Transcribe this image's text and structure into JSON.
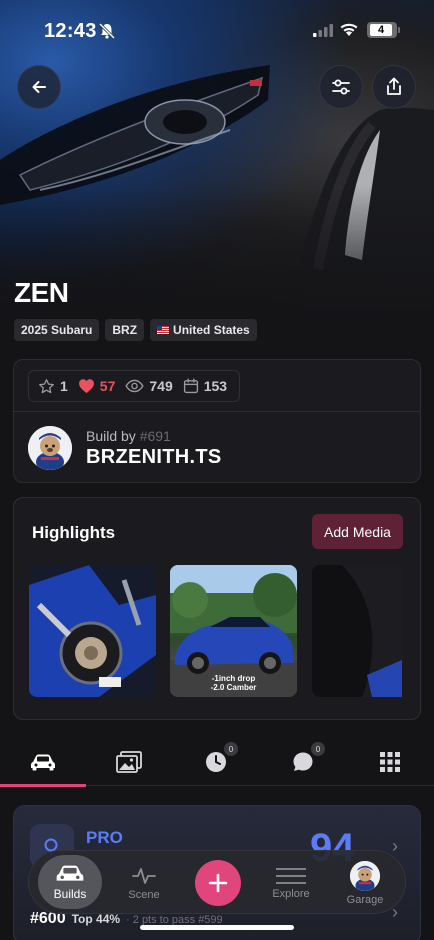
{
  "status_bar": {
    "time": "12:43",
    "battery": "4"
  },
  "header": {
    "title": "ZEN",
    "tags": [
      "2025 Subaru",
      "BRZ",
      "United States"
    ]
  },
  "stats": {
    "stars": "1",
    "likes": "57",
    "views": "749",
    "days": "153"
  },
  "owner": {
    "build_by_label": "Build by",
    "build_number": "#691",
    "name": "BRZENITH.TS"
  },
  "highlights": {
    "title": "Highlights",
    "add_media_label": "Add Media",
    "thumb_caption_line1": "-1inch drop",
    "thumb_caption_line2": "-2.0 Camber"
  },
  "tabs": {
    "timeline_badge": "0",
    "comments_badge": "0"
  },
  "pro_card": {
    "label": "PRO",
    "score": "94",
    "rank": "#600",
    "top_percent": "Top 44%",
    "pass_text": "· 2 pts to pass #599"
  },
  "nav": {
    "builds": "Builds",
    "scene": "Scene",
    "explore": "Explore",
    "garage": "Garage"
  },
  "colors": {
    "accent": "#e0457b",
    "pro_blue": "#5b7cf7",
    "like_red": "#e9525e",
    "add_media_bg": "#5e2136"
  }
}
